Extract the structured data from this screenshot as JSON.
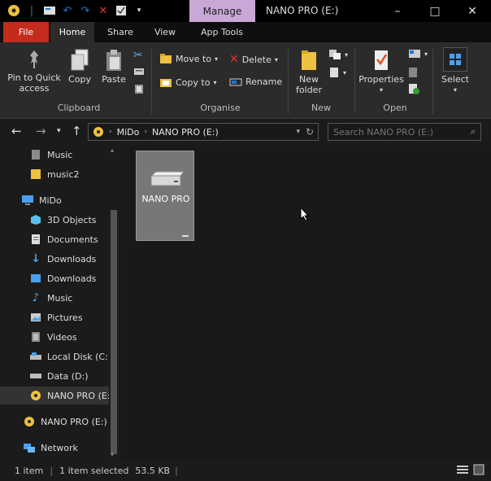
{
  "titlebar": {
    "manage_tab": "Manage",
    "window_title": "NANO PRO (E:)",
    "minimize": "–",
    "maximize": "□",
    "close": "✕"
  },
  "ribbon_tabs": [
    "File",
    "Home",
    "Share",
    "View",
    "App Tools"
  ],
  "ribbon": {
    "clipboard": {
      "pin_label_1": "Pin to Quick",
      "pin_label_2": "access",
      "copy": "Copy",
      "paste": "Paste",
      "group": "Clipboard"
    },
    "organise": {
      "move_to": "Move to",
      "copy_to": "Copy to",
      "delete": "Delete",
      "rename": "Rename",
      "group": "Organise"
    },
    "new": {
      "new_folder_1": "New",
      "new_folder_2": "folder",
      "group": "New"
    },
    "open": {
      "properties": "Properties",
      "group": "Open"
    },
    "select": {
      "select": "Select"
    }
  },
  "address": {
    "path": [
      "MiDo",
      "NANO PRO (E:)"
    ],
    "search_placeholder": "Search NANO PRO (E:)"
  },
  "sidebar": {
    "items": [
      {
        "label": "Music",
        "icon": "music-folder-icon"
      },
      {
        "label": "music2",
        "icon": "folder-icon"
      },
      {
        "label": "MiDo",
        "icon": "computer-icon"
      },
      {
        "label": "3D Objects",
        "icon": "3d-objects-icon"
      },
      {
        "label": "Documents",
        "icon": "documents-icon"
      },
      {
        "label": "Downloads",
        "icon": "downloads-icon"
      },
      {
        "label": "Downloads",
        "icon": "downloads-icon"
      },
      {
        "label": "Music",
        "icon": "music-icon"
      },
      {
        "label": "Pictures",
        "icon": "pictures-icon"
      },
      {
        "label": "Videos",
        "icon": "videos-icon"
      },
      {
        "label": "Local Disk (C:)",
        "icon": "local-disk-icon"
      },
      {
        "label": "Data (D:)",
        "icon": "drive-icon"
      },
      {
        "label": "NANO PRO (E:)",
        "icon": "cd-drive-icon"
      },
      {
        "label": "NANO PRO (E:)",
        "icon": "cd-drive-icon"
      },
      {
        "label": "Network",
        "icon": "network-icon"
      }
    ]
  },
  "content": {
    "tile_label": "NANO PRO"
  },
  "status": {
    "count": "1 item",
    "selected": "1 item selected",
    "size": "53.5 KB"
  },
  "colors": {
    "file_tab": "#c42b1c",
    "manage_tab": "#c9a8d8",
    "accent": "#1a78d6"
  }
}
